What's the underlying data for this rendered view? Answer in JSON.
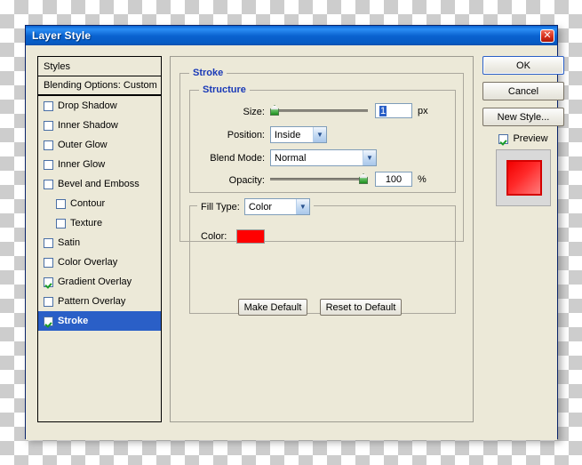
{
  "window": {
    "title": "Layer Style",
    "close_icon": "close-icon"
  },
  "styles_panel": {
    "header": "Styles",
    "blending_options": "Blending Options: Custom",
    "effects": [
      {
        "label": "Drop Shadow",
        "checked": false,
        "selected": false,
        "indent": false
      },
      {
        "label": "Inner Shadow",
        "checked": false,
        "selected": false,
        "indent": false
      },
      {
        "label": "Outer Glow",
        "checked": false,
        "selected": false,
        "indent": false
      },
      {
        "label": "Inner Glow",
        "checked": false,
        "selected": false,
        "indent": false
      },
      {
        "label": "Bevel and Emboss",
        "checked": false,
        "selected": false,
        "indent": false
      },
      {
        "label": "Contour",
        "checked": false,
        "selected": false,
        "indent": true
      },
      {
        "label": "Texture",
        "checked": false,
        "selected": false,
        "indent": true
      },
      {
        "label": "Satin",
        "checked": false,
        "selected": false,
        "indent": false
      },
      {
        "label": "Color Overlay",
        "checked": false,
        "selected": false,
        "indent": false
      },
      {
        "label": "Gradient Overlay",
        "checked": true,
        "selected": false,
        "indent": false
      },
      {
        "label": "Pattern Overlay",
        "checked": false,
        "selected": false,
        "indent": false
      },
      {
        "label": "Stroke",
        "checked": true,
        "selected": true,
        "indent": false
      }
    ]
  },
  "main": {
    "group_title": "Stroke",
    "structure": {
      "legend": "Structure",
      "size_label": "Size:",
      "size_value": "1",
      "size_unit": "px",
      "size_slider_pct": 0,
      "position_label": "Position:",
      "position_value": "Inside",
      "blend_mode_label": "Blend Mode:",
      "blend_mode_value": "Normal",
      "opacity_label": "Opacity:",
      "opacity_value": "100",
      "opacity_unit": "%",
      "opacity_slider_pct": 100
    },
    "fill_type": {
      "legend": "Fill Type:",
      "value": "Color",
      "color_label": "Color:",
      "color_hex": "#FF0000"
    },
    "make_default": "Make Default",
    "reset_to_default": "Reset to Default"
  },
  "right": {
    "ok": "OK",
    "cancel": "Cancel",
    "new_style": "New Style...",
    "preview_label": "Preview",
    "preview_checked": true
  }
}
